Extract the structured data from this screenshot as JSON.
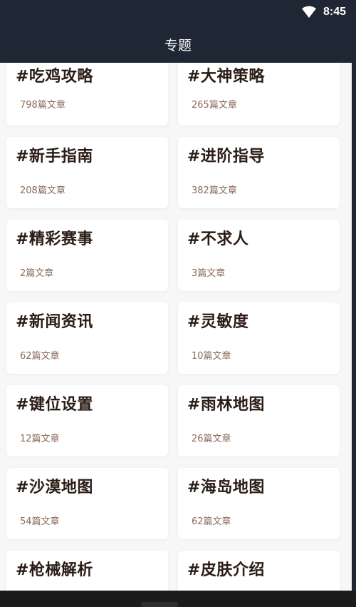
{
  "status_bar": {
    "time": "8:45",
    "wifi_icon": "wifi-icon"
  },
  "app_bar": {
    "title": "专题"
  },
  "topics": [
    {
      "title": "#吃鸡攻略",
      "count": "798篇文章"
    },
    {
      "title": "#大神策略",
      "count": "265篇文章"
    },
    {
      "title": "#新手指南",
      "count": "208篇文章"
    },
    {
      "title": "#进阶指导",
      "count": "382篇文章"
    },
    {
      "title": "#精彩赛事",
      "count": "2篇文章"
    },
    {
      "title": "#不求人",
      "count": "3篇文章"
    },
    {
      "title": "#新闻资讯",
      "count": "62篇文章"
    },
    {
      "title": "#灵敏度",
      "count": "10篇文章"
    },
    {
      "title": "#键位设置",
      "count": "12篇文章"
    },
    {
      "title": "#雨林地图",
      "count": "26篇文章"
    },
    {
      "title": "#沙漠地图",
      "count": "54篇文章"
    },
    {
      "title": "#海岛地图",
      "count": "62篇文章"
    },
    {
      "title": "#枪械解析",
      "count": ""
    },
    {
      "title": "#皮肤介绍",
      "count": ""
    }
  ],
  "colors": {
    "header_bg": "#1e2733",
    "content_bg": "#f7f7f7",
    "title_text": "#2b1c16",
    "count_text": "#8a6b5a"
  }
}
